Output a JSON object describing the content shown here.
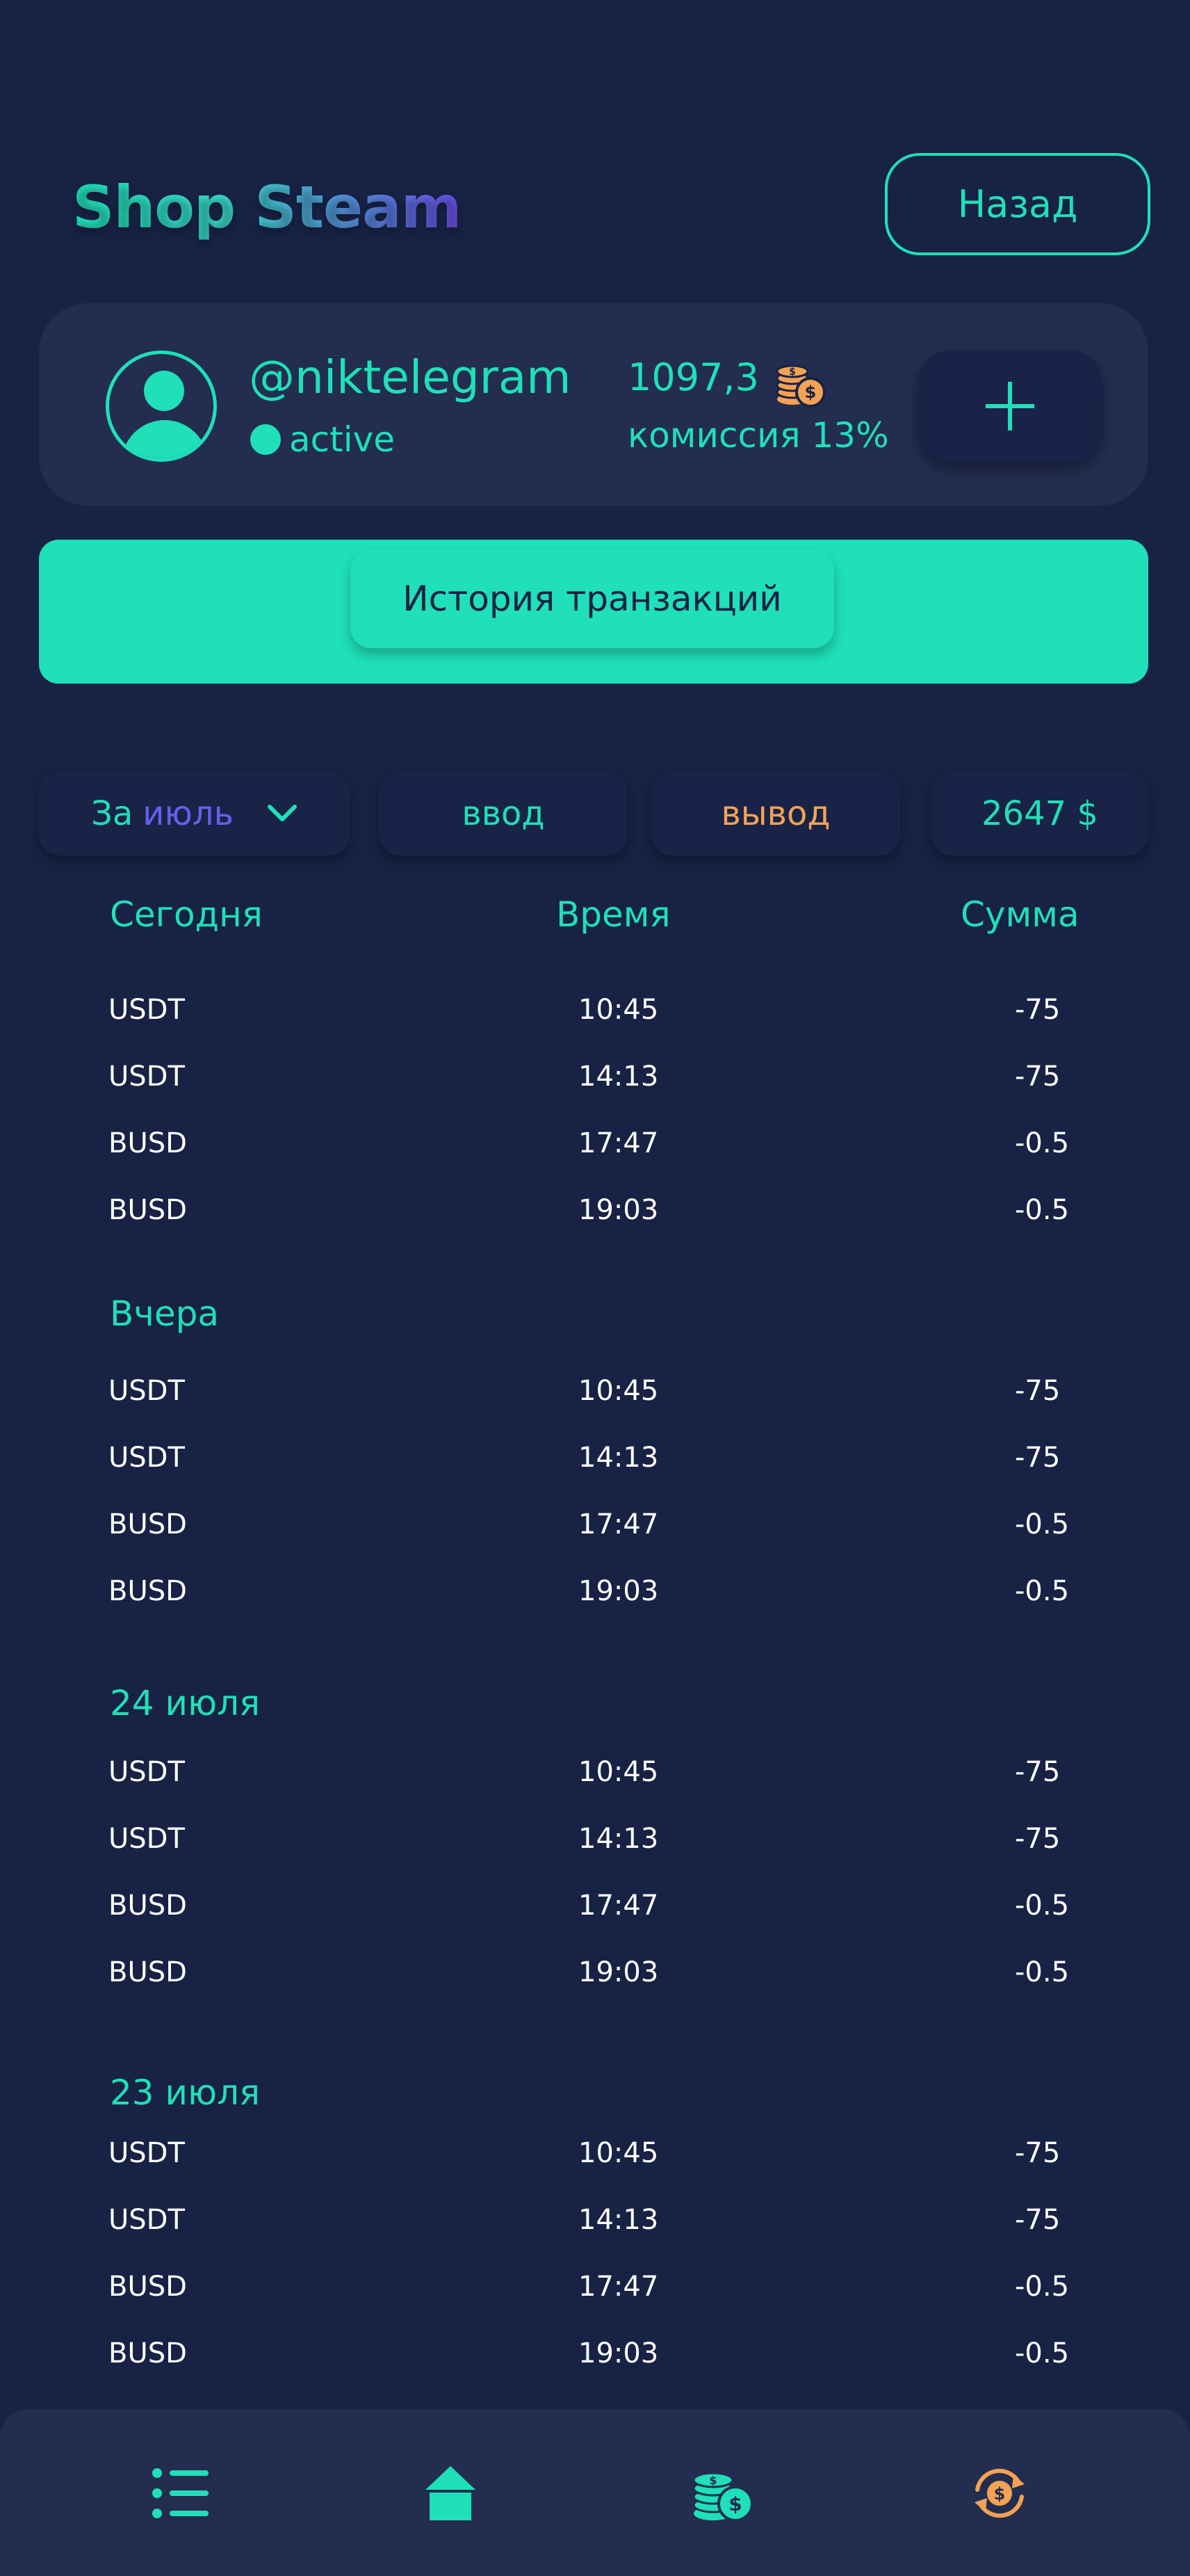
{
  "header": {
    "logo_text": "Shop Steam",
    "back_label": "Назад"
  },
  "profile": {
    "username": "@niktelegram",
    "status": "active",
    "balance": "1097,3",
    "commission": "комиссия 13%",
    "add_icon": "plus-icon",
    "coins_icon": "coins-dollar-icon"
  },
  "history": {
    "button_label": "История транзакций"
  },
  "filters": {
    "month_prefix": "За",
    "month": "июль",
    "deposit": "ввод",
    "withdraw": "вывод",
    "total": "2647 $"
  },
  "table": {
    "headers": [
      "Сегодня",
      "Время",
      "Сумма"
    ],
    "sections": [
      {
        "title": "Сегодня",
        "rows": [
          {
            "name": "USDT",
            "time": "10:45",
            "sum": "-75"
          },
          {
            "name": "USDT",
            "time": "14:13",
            "sum": "-75"
          },
          {
            "name": "BUSD",
            "time": "17:47",
            "sum": "-0.5"
          },
          {
            "name": "BUSD",
            "time": "19:03",
            "sum": "-0.5"
          }
        ]
      },
      {
        "title": "Вчера",
        "rows": [
          {
            "name": "USDT",
            "time": "10:45",
            "sum": "-75"
          },
          {
            "name": "USDT",
            "time": "14:13",
            "sum": "-75"
          },
          {
            "name": "BUSD",
            "time": "17:47",
            "sum": "-0.5"
          },
          {
            "name": "BUSD",
            "time": "19:03",
            "sum": "-0.5"
          }
        ]
      },
      {
        "title": "24 июля",
        "rows": [
          {
            "name": "USDT",
            "time": "10:45",
            "sum": "-75"
          },
          {
            "name": "USDT",
            "time": "14:13",
            "sum": "-75"
          },
          {
            "name": "BUSD",
            "time": "17:47",
            "sum": "-0.5"
          },
          {
            "name": "BUSD",
            "time": "19:03",
            "sum": "-0.5"
          }
        ]
      },
      {
        "title": "23 июля",
        "rows": [
          {
            "name": "USDT",
            "time": "10:45",
            "sum": "-75"
          },
          {
            "name": "USDT",
            "time": "14:13",
            "sum": "-75"
          },
          {
            "name": "BUSD",
            "time": "17:47",
            "sum": "-0.5"
          },
          {
            "name": "BUSD",
            "time": "19:03",
            "sum": "-0.5"
          }
        ]
      }
    ]
  },
  "nav": {
    "items": [
      "list-icon",
      "home-icon",
      "coins-dollar-icon",
      "exchange-icon"
    ]
  },
  "colors": {
    "background": "#172244",
    "card": "#222d50",
    "accent": "#1fe0b8",
    "orange": "#f4a254",
    "purple": "#6a5cf0"
  }
}
